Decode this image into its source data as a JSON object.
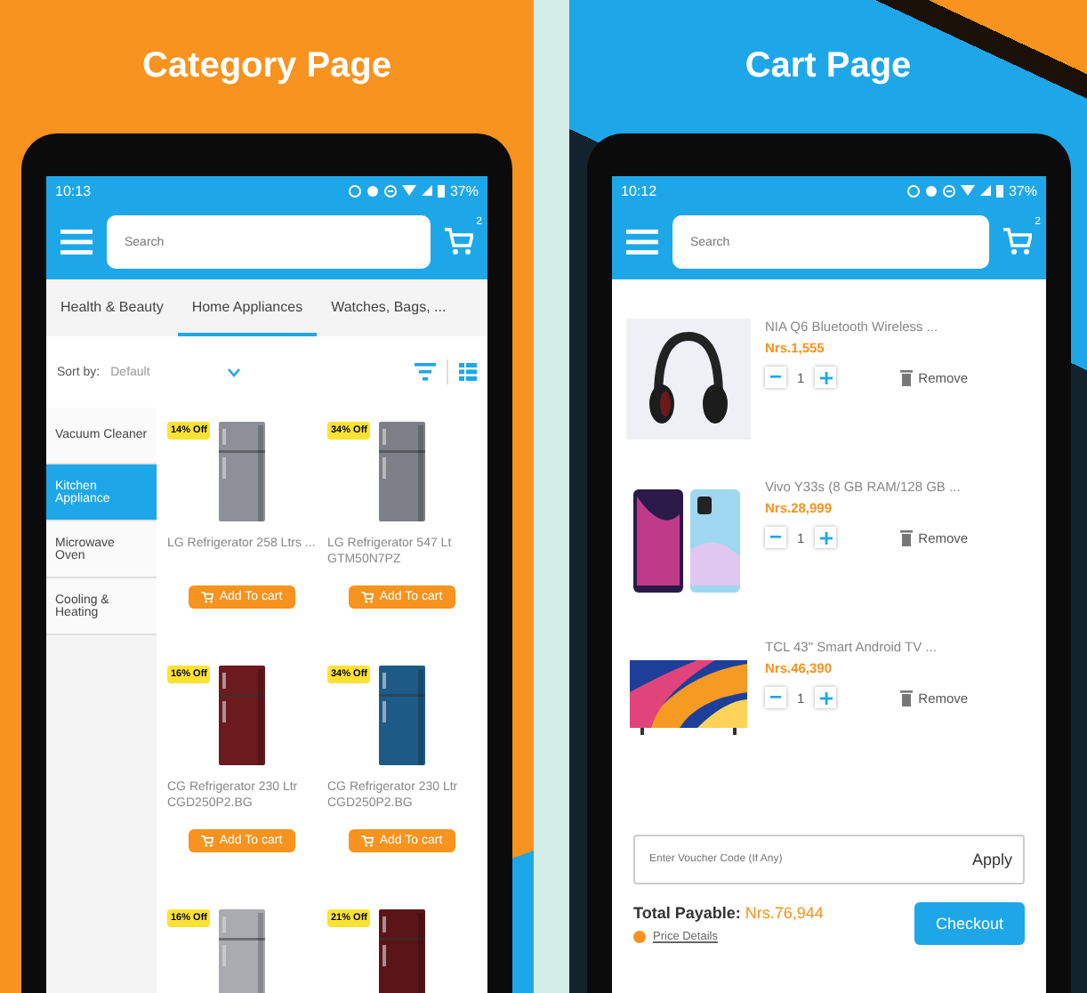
{
  "panels": [
    {
      "kind": "category",
      "title": "Category Page",
      "status": {
        "time": "10:13",
        "battery": "37%"
      },
      "search": {
        "placeholder": "Search"
      },
      "cart_count": "2",
      "tabs": [
        {
          "label": "Health & Beauty",
          "selected": false
        },
        {
          "label": "Home Appliances",
          "selected": true
        },
        {
          "label": "Watches, Bags, ...",
          "selected": false
        }
      ],
      "sort": {
        "label": "Sort by:",
        "value": "Default"
      },
      "categories": [
        {
          "label": "Vacuum Cleaner",
          "selected": false
        },
        {
          "label": "Kitchen Appliance",
          "selected": true
        },
        {
          "label": "Microwave Oven",
          "selected": false
        },
        {
          "label": "Cooling & Heating",
          "selected": false
        }
      ],
      "products": [
        {
          "badge": "14% Off",
          "name": "LG Refrigerator 258 Ltrs ...",
          "button": "Add To cart"
        },
        {
          "badge": "34% Off",
          "name": "LG Refrigerator 547 Lt GTM50N7PZ",
          "button": "Add To cart"
        },
        {
          "badge": "16% Off",
          "name": "CG Refrigerator 230 Ltr CGD250P2.BG",
          "button": "Add To cart"
        },
        {
          "badge": "34% Off",
          "name": "CG Refrigerator 230 Ltr CGD250P2.BG",
          "button": "Add To cart"
        },
        {
          "badge": "16% Off"
        },
        {
          "badge": "21% Off"
        }
      ]
    },
    {
      "kind": "cart",
      "title": "Cart Page",
      "status": {
        "time": "10:12",
        "battery": "37%"
      },
      "search": {
        "placeholder": "Search"
      },
      "cart_count": "2",
      "items": [
        {
          "name": "NIA Q6 Bluetooth Wireless ...",
          "price": "Nrs.1,555",
          "qty": "1",
          "remove": "Remove"
        },
        {
          "name": "Vivo Y33s (8 GB RAM/128 GB ...",
          "price": "Nrs.28,999",
          "qty": "1",
          "remove": "Remove"
        },
        {
          "name": "TCL 43\" Smart Android TV ...",
          "price": "Nrs.46,390",
          "qty": "1",
          "remove": "Remove"
        }
      ],
      "voucher": {
        "placeholder": "Enter Voucher Code (If Any)",
        "button": "Apply"
      },
      "total": {
        "label": "Total Payable:",
        "value": "Nrs.76,944"
      },
      "price_details": "Price Details",
      "checkout": "Checkout"
    }
  ]
}
